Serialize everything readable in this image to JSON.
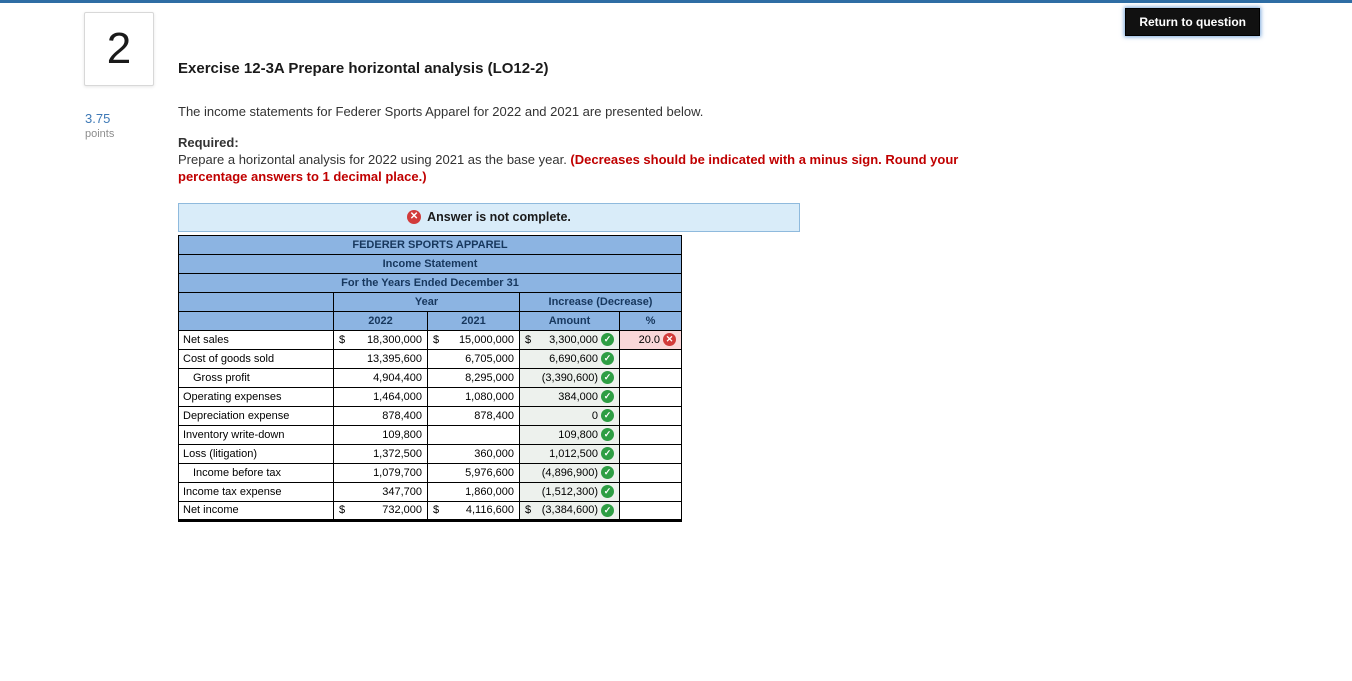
{
  "header": {
    "return_button": "Return to question"
  },
  "question": {
    "number": "2",
    "points_value": "3.75",
    "points_label": "points"
  },
  "exercise": {
    "title": "Exercise 12-3A Prepare horizontal analysis (LO12-2)",
    "intro": "The income statements for Federer Sports Apparel for 2022 and 2021 are presented below.",
    "required_label": "Required:",
    "required_text": "Prepare a horizontal analysis for 2022 using 2021 as the base year. ",
    "required_emphasis": "(Decreases should be indicated with a minus sign. Round your percentage answers to 1 decimal place.)"
  },
  "answer_banner": {
    "text": "Answer is not complete."
  },
  "table": {
    "title_rows": [
      "FEDERER SPORTS APPAREL",
      "Income Statement",
      "For the Years Ended December 31"
    ],
    "group_headers": {
      "year": "Year",
      "increase_decrease": "Increase (Decrease)"
    },
    "col_headers": [
      "2022",
      "2021",
      "Amount",
      "%"
    ],
    "rows": [
      {
        "label": "Net sales",
        "indent": 0,
        "c2022": {
          "d": "$",
          "v": "18,300,000"
        },
        "c2021": {
          "d": "$",
          "v": "15,000,000"
        },
        "amount": {
          "d": "$",
          "v": "3,300,000",
          "mark": "correct"
        },
        "pct": {
          "v": "20.0",
          "mark": "incorrect"
        }
      },
      {
        "label": "Cost of goods sold",
        "indent": 0,
        "c2022": {
          "v": "13,395,600"
        },
        "c2021": {
          "v": "6,705,000"
        },
        "amount": {
          "v": "6,690,600",
          "mark": "correct"
        },
        "pct": {}
      },
      {
        "label": "Gross profit",
        "indent": 1,
        "c2022": {
          "v": "4,904,400"
        },
        "c2021": {
          "v": "8,295,000"
        },
        "amount": {
          "v": "(3,390,600)",
          "mark": "correct"
        },
        "pct": {}
      },
      {
        "label": "Operating expenses",
        "indent": 0,
        "c2022": {
          "v": "1,464,000"
        },
        "c2021": {
          "v": "1,080,000"
        },
        "amount": {
          "v": "384,000",
          "mark": "correct"
        },
        "pct": {}
      },
      {
        "label": "Depreciation expense",
        "indent": 0,
        "c2022": {
          "v": "878,400"
        },
        "c2021": {
          "v": "878,400"
        },
        "amount": {
          "v": "0",
          "mark": "correct"
        },
        "pct": {}
      },
      {
        "label": "Inventory write-down",
        "indent": 0,
        "c2022": {
          "v": "109,800"
        },
        "c2021": {},
        "amount": {
          "v": "109,800",
          "mark": "correct"
        },
        "pct": {}
      },
      {
        "label": "Loss (litigation)",
        "indent": 0,
        "c2022": {
          "v": "1,372,500"
        },
        "c2021": {
          "v": "360,000"
        },
        "amount": {
          "v": "1,012,500",
          "mark": "correct"
        },
        "pct": {}
      },
      {
        "label": "Income before tax",
        "indent": 1,
        "c2022": {
          "v": "1,079,700"
        },
        "c2021": {
          "v": "5,976,600"
        },
        "amount": {
          "v": "(4,896,900)",
          "mark": "correct"
        },
        "pct": {}
      },
      {
        "label": "Income tax expense",
        "indent": 0,
        "c2022": {
          "v": "347,700"
        },
        "c2021": {
          "v": "1,860,000"
        },
        "amount": {
          "v": "(1,512,300)",
          "mark": "correct"
        },
        "pct": {}
      },
      {
        "label": "Net income",
        "indent": 0,
        "c2022": {
          "d": "$",
          "v": "732,000"
        },
        "c2021": {
          "d": "$",
          "v": "4,116,600"
        },
        "amount": {
          "d": "$",
          "v": "(3,384,600)",
          "mark": "correct"
        },
        "pct": {}
      }
    ]
  },
  "colors": {
    "topbar_blue": "#2e6da4",
    "header_blue": "#8cb4e2",
    "header_text": "#17375d",
    "banner_bg": "#d9ecf9",
    "banner_border": "#8fbadd",
    "correct_green": "#2e9e44",
    "incorrect_red": "#d23b3b",
    "emphasis_red": "#c00000",
    "points_blue": "#3e79b6",
    "input_bg": "#edf1ed",
    "wrong_bg": "#f9d7d9",
    "button_black": "#111111"
  }
}
